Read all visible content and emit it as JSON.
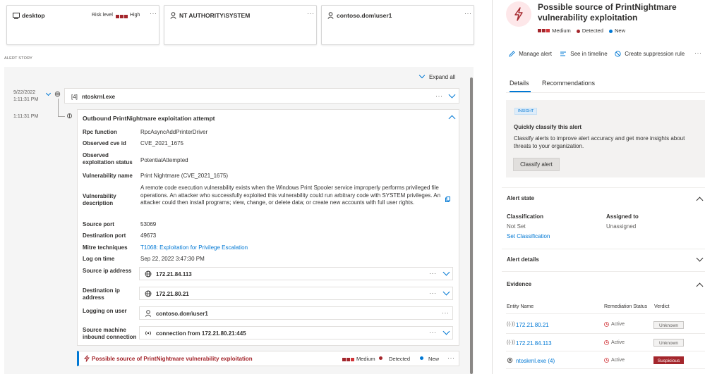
{
  "cards": {
    "device": {
      "name": "desktop",
      "risk_label": "Risk level",
      "risk_value": "High"
    },
    "user1": {
      "name": "NT AUTHORITY\\SYSTEM"
    },
    "user2": {
      "name": "contoso.dom\\user1"
    },
    "more": "···"
  },
  "story": {
    "heading": "ALERT STORY",
    "expand_all": "Expand all",
    "process": {
      "date": "9/22/2022",
      "time": "1:11:31 PM",
      "count": "[4]",
      "name": "ntoskrnl.exe"
    },
    "event": {
      "time": "1:11:31 PM",
      "title": "Outbound PrintNightmare exploitation attempt"
    },
    "fields": [
      {
        "label": "Rpc function",
        "value": "RpcAsyncAddPrinterDriver"
      },
      {
        "label": "Observed cve id",
        "value": "CVE_2021_1675"
      },
      {
        "label": "Observed exploitation status",
        "value": "PotentialAttempted"
      },
      {
        "label": "Vulnerability name",
        "value": "Print Nightmare (CVE_2021_1675)"
      },
      {
        "label": "Vulnerability description",
        "value": "A remote code execution vulnerability exists when the Windows Print Spooler service improperly performs privileged file operations. An attacker who successfully exploited this vulnerability could run arbitrary code with SYSTEM privileges. An attacker could then install programs; view, change, or delete data; or create new accounts with full user rights."
      },
      {
        "label": "Source port",
        "value": "53069"
      },
      {
        "label": "Destination port",
        "value": "49673"
      },
      {
        "label": "Mitre techniques",
        "value": "T1068: Exploitation for Privilege Escalation"
      },
      {
        "label": "Log on time",
        "value": "Sep 22, 2022 3:47:30 PM"
      }
    ],
    "entities": [
      {
        "label": "Source ip address",
        "value": "172.21.84.113",
        "icon": "globe-icon"
      },
      {
        "label": "Destination ip address",
        "value": "172.21.80.21",
        "icon": "globe-icon"
      },
      {
        "label": "Logging on user",
        "value": "contoso.dom\\user1",
        "icon": "user-icon"
      },
      {
        "label": "Source machine inbound connection",
        "value": "connection from 172.21.80.21:445",
        "icon": "connection-icon"
      }
    ],
    "alert_row": {
      "title": "Possible source of PrintNightmare vulnerability exploitation",
      "severity": "Medium",
      "status": "Detected",
      "state": "New"
    }
  },
  "panel": {
    "title": "Possible source of PrintNightmare vulnerability exploitation",
    "severity": "Medium",
    "status": "Detected",
    "state": "New",
    "actions": [
      "Manage alert",
      "See in timeline",
      "Create suppression rule"
    ],
    "tabs": [
      "Details",
      "Recommendations"
    ],
    "insight": {
      "badge": "INSIGHT",
      "title": "Quickly classify this alert",
      "text": "Classify alerts to improve alert accuracy and get more insights about threats to your organization.",
      "button": "Classify alert"
    },
    "alert_state": {
      "heading": "Alert state",
      "classification_label": "Classification",
      "classification_value": "Not Set",
      "set_link": "Set Classification",
      "assigned_label": "Assigned to",
      "assigned_value": "Unassigned"
    },
    "alert_details": "Alert details",
    "evidence": {
      "heading": "Evidence",
      "columns": [
        "Entity Name",
        "Remediation Status",
        "Verdict"
      ],
      "rows": [
        {
          "name": "172.21.80.21",
          "status": "Active",
          "verdict": "Unknown"
        },
        {
          "name": "172.21.84.113",
          "status": "Active",
          "verdict": "Unknown"
        },
        {
          "name": "ntoskrnl.exe (4)",
          "status": "Active",
          "verdict": "Suspicious"
        }
      ]
    }
  },
  "colors": {
    "accent": "#0078d4",
    "severity": "#a4262c",
    "suspicious": "#a4262c"
  }
}
